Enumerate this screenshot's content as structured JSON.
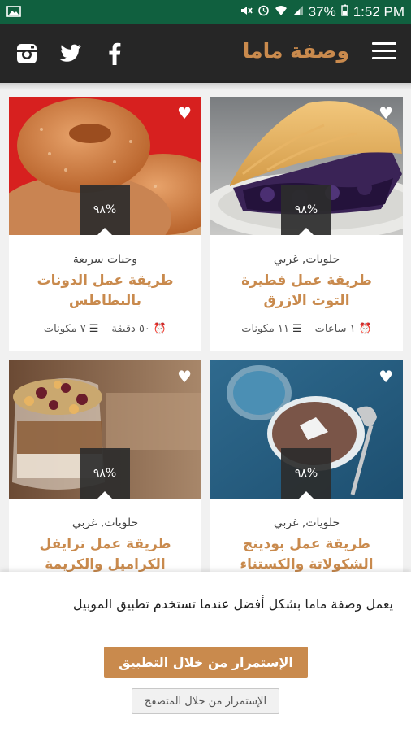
{
  "status_bar": {
    "battery": "37%",
    "time": "1:52 PM",
    "icons": [
      "image-icon",
      "mute-icon",
      "alarm-icon",
      "wifi-icon",
      "signal-icon",
      "battery-icon"
    ]
  },
  "app_bar": {
    "brand": "وصفة ماما",
    "social": [
      "instagram-icon",
      "twitter-icon",
      "facebook-icon"
    ],
    "menu_icon": "hamburger-menu-icon"
  },
  "cards": [
    {
      "category": "حلويات, غربي",
      "title": "طريقة عمل فطيرة التوت الازرق",
      "rating": "٩٨%",
      "time": "١ ساعات",
      "ingredients": "١١ مكونات",
      "image": "blueberry-pie"
    },
    {
      "category": "وجبات سريعة",
      "title": "طريقة عمل الدونات بالبطاطس",
      "rating": "٩٨%",
      "time": "٥٠ دقيقة",
      "ingredients": "٧ مكونات",
      "image": "donuts"
    },
    {
      "category": "حلويات, غربي",
      "title": "طريقة عمل بودينج الشكولاتة والكستناء",
      "rating": "٩٨%",
      "image": "chocolate-pudding"
    },
    {
      "category": "حلويات, غربي",
      "title": "طريقة عمل ترايفل الكراميل والكريمة",
      "rating": "٩٨%",
      "image": "caramel-trifle"
    }
  ],
  "prompt": {
    "message": "يعمل وصفة ماما بشكل أفضل عندما تستخدم تطبيق الموبيل",
    "app_button": "الإستمرار من خلال التطبيق",
    "web_button": "الإستمرار من خلال المتصفح"
  },
  "colors": {
    "status_bar": "#10603f",
    "app_bar": "#262626",
    "accent": "#c98a4d"
  }
}
